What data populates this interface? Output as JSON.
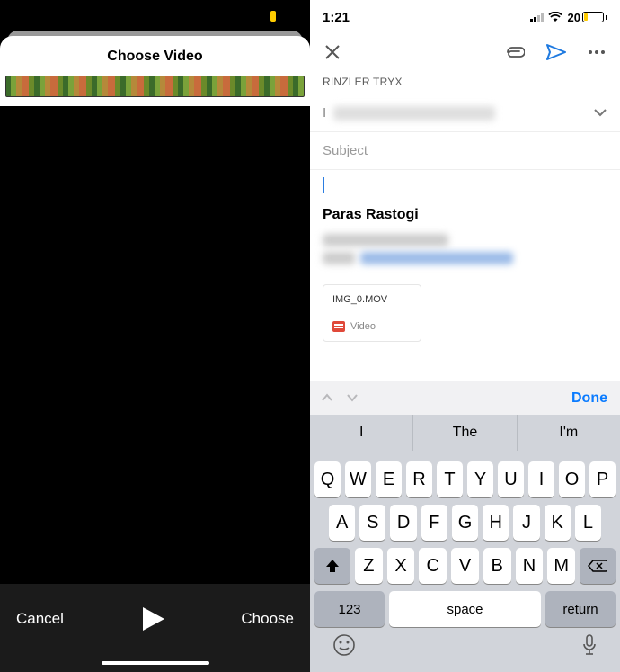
{
  "left": {
    "title": "Choose Video",
    "cancel": "Cancel",
    "choose": "Choose"
  },
  "right": {
    "status": {
      "time": "1:21",
      "battery": "20"
    },
    "from_label": "RINZLER TRYX",
    "to_prefix": "I",
    "subject_placeholder": "Subject",
    "signature_name": "Paras Rastogi",
    "attachment": {
      "filename": "IMG_0.MOV",
      "type_label": "Video"
    },
    "accessory": {
      "done": "Done"
    },
    "keyboard": {
      "suggestions": [
        "I",
        "The",
        "I'm"
      ],
      "row1": [
        "Q",
        "W",
        "E",
        "R",
        "T",
        "Y",
        "U",
        "I",
        "O",
        "P"
      ],
      "row2": [
        "A",
        "S",
        "D",
        "F",
        "G",
        "H",
        "J",
        "K",
        "L"
      ],
      "row3": [
        "Z",
        "X",
        "C",
        "V",
        "B",
        "N",
        "M"
      ],
      "numKey": "123",
      "space": "space",
      "return": "return"
    }
  }
}
